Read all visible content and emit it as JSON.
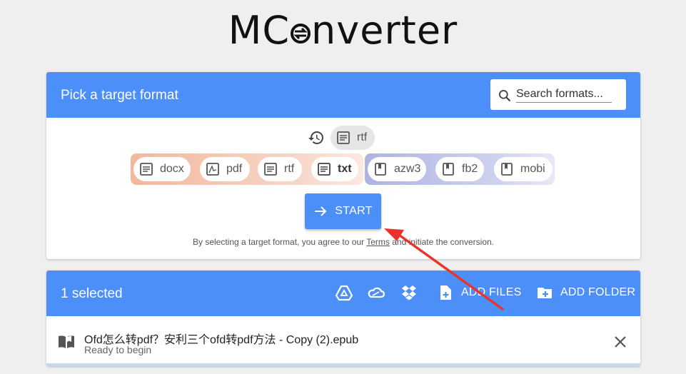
{
  "logo": {
    "prefix": "MC",
    "suffix": "nverter"
  },
  "picker": {
    "title": "Pick a target format",
    "search_placeholder": "Search formats...",
    "recent": [
      {
        "label": "rtf",
        "icon": "document-icon"
      }
    ],
    "document_formats": [
      {
        "label": "docx",
        "icon": "document-icon"
      },
      {
        "label": "pdf",
        "icon": "pdf-icon"
      },
      {
        "label": "rtf",
        "icon": "document-icon"
      },
      {
        "label": "txt",
        "icon": "document-icon",
        "selected": true
      }
    ],
    "ebook_formats": [
      {
        "label": "azw3",
        "icon": "book-icon"
      },
      {
        "label": "fb2",
        "icon": "book-icon"
      },
      {
        "label": "mobi",
        "icon": "book-icon"
      }
    ],
    "start_label": "START",
    "terms_before": "By selecting a target format, you agree to our ",
    "terms_link": "Terms",
    "terms_after": " and initiate the conversion."
  },
  "files": {
    "selected_count_label": "1 selected",
    "add_files_label": "ADD FILES",
    "add_folder_label": "ADD FOLDER",
    "items": [
      {
        "name": "Ofd怎么转pdf？安利三个ofd转pdf方法 - Copy (2).epub",
        "status": "Ready to begin"
      }
    ]
  },
  "colors": {
    "accent": "#4d8ff8",
    "annotation_arrow": "#e8342b"
  }
}
